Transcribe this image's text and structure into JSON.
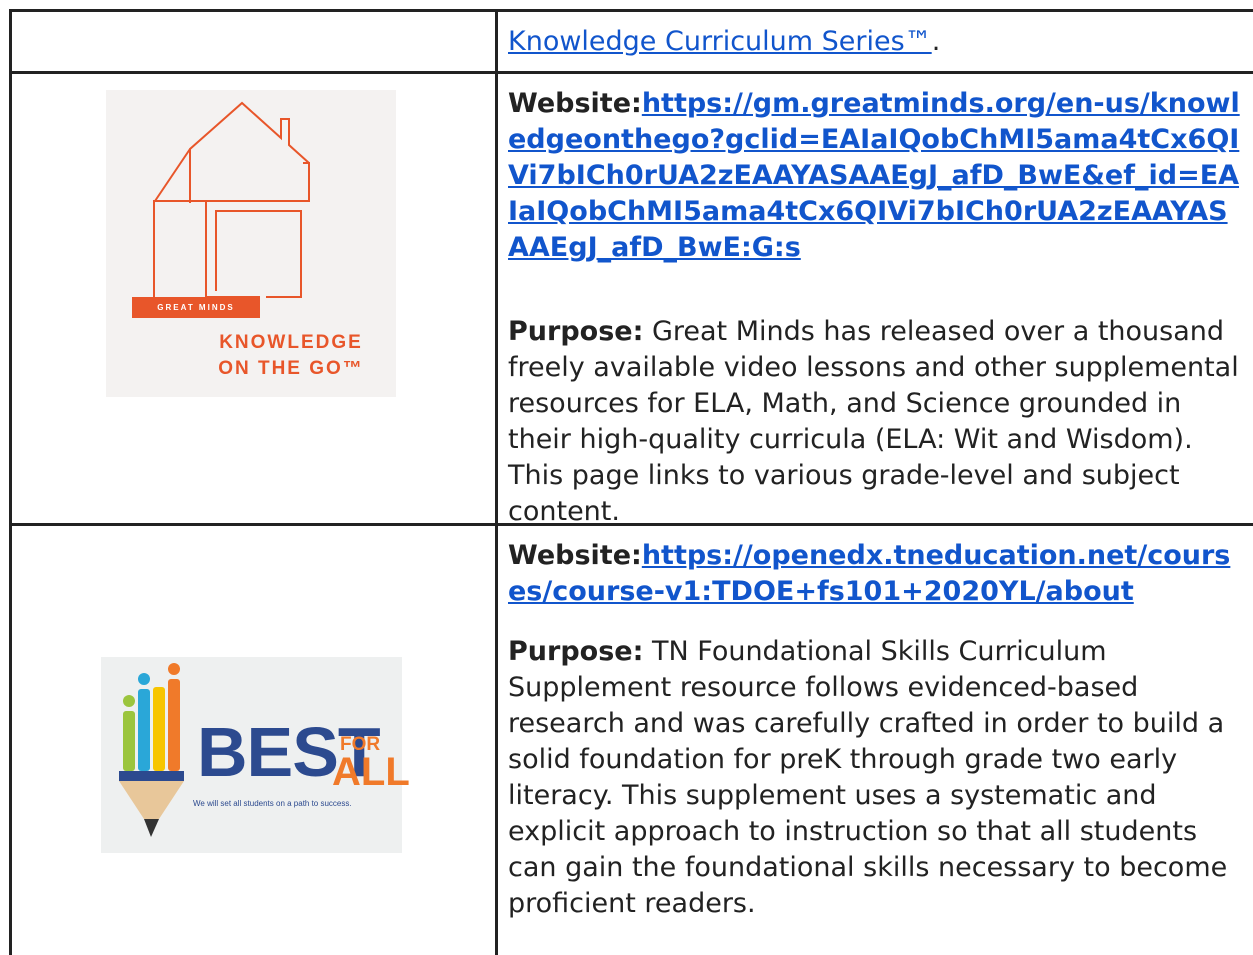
{
  "row1": {
    "link_text": "Knowledge Curriculum Series™",
    "trailing": "."
  },
  "row2": {
    "logo": {
      "brand_strip": "GREAT MINDS",
      "line1": "KNOWLEDGE",
      "line2": "ON THE GO™"
    },
    "website_label": "Website:",
    "website_url": "https://gm.greatminds.org/en-us/knowledgeonthego?gclid=EAIaIQobChMI5ama4tCx6QIVi7bICh0rUA2zEAAYASAAEgJ_afD_BwE&ef_id=EAIaIQobChMI5ama4tCx6QIVi7bICh0rUA2zEAAYASAAEgJ_afD_BwE:G:s",
    "purpose_label": "Purpose:",
    "purpose_text": " Great Minds has released over a thousand freely available video lessons and other supplemental resources for ELA, Math, and Science grounded in their high-quality curricula (ELA: Wit and Wisdom). This page links to various grade-level and subject content."
  },
  "row3": {
    "logo": {
      "word": "BEST",
      "for": "FOR",
      "all": "ALL",
      "tagline": "We will set all students on a path to success."
    },
    "website_label": "Website:",
    "website_url": "https://openedx.tneducation.net/courses/course-v1:TDOE+fs101+2020YL/about",
    "purpose_label": "Purpose:",
    "purpose_text": " TN Foundational Skills Curriculum Supplement resource follows evidenced-based research and was carefully crafted in order to build a solid foundation for preK through grade two early literacy. This supplement uses a systematic and explicit approach to instruction so that all students can gain the foundational skills necessary to become proficient readers."
  },
  "colors": {
    "link": "#1155cc",
    "great_minds_orange": "#e8562a",
    "best_blue": "#2c4a8f",
    "best_orange": "#f07a2a"
  }
}
